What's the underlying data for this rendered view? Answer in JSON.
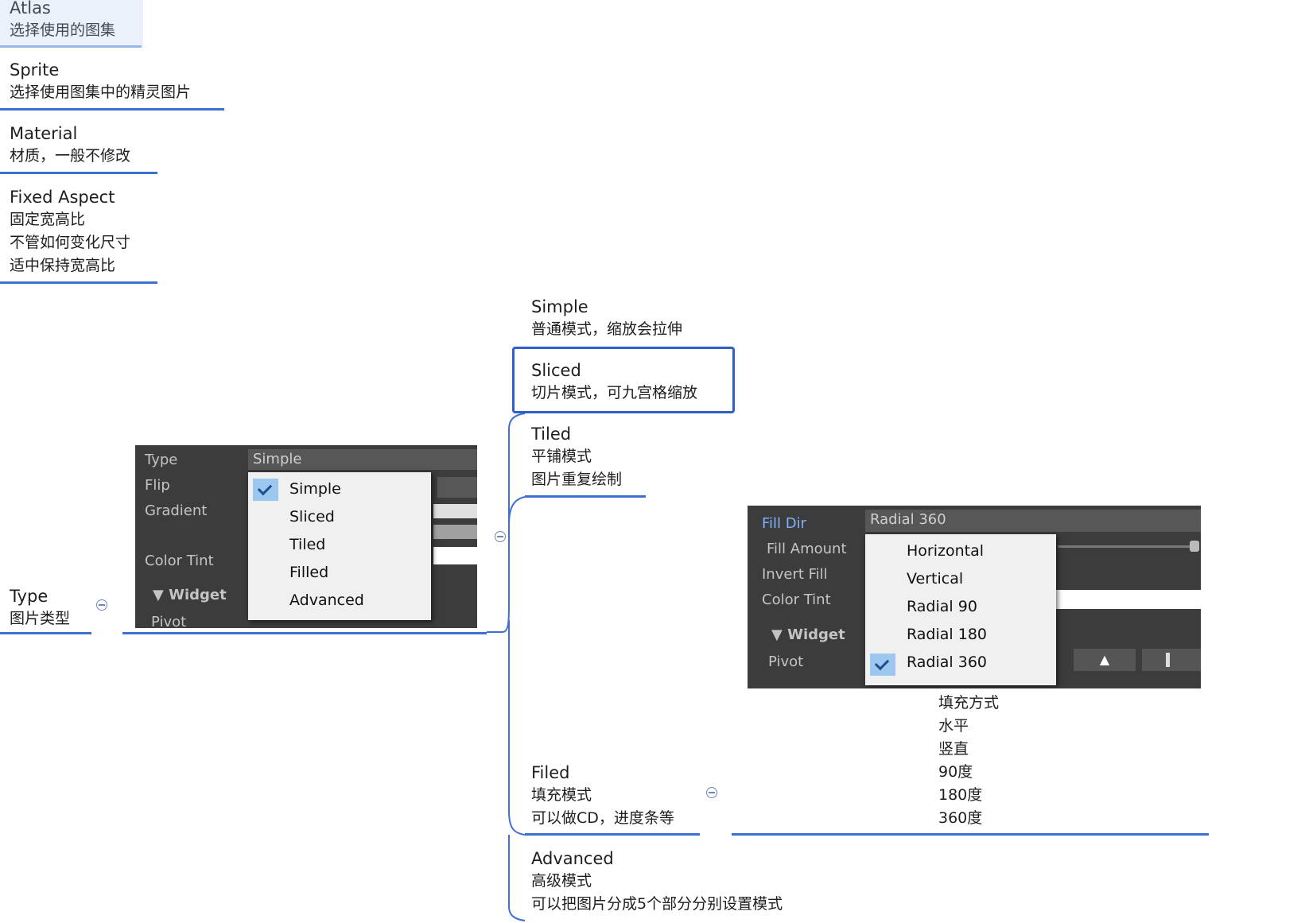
{
  "left_nodes": {
    "atlas": {
      "title": "Atlas",
      "desc": "选择使用的图集"
    },
    "sprite": {
      "title": "Sprite",
      "desc": "选择使用图集中的精灵图片"
    },
    "material": {
      "title": "Material",
      "desc": "材质，一般不修改"
    },
    "fixed_aspect": {
      "title": "Fixed Aspect",
      "lines": [
        "固定宽高比",
        "不管如何变化尺寸",
        "适中保持宽高比"
      ]
    },
    "type": {
      "title": "Type",
      "desc": "图片类型"
    }
  },
  "type_panel": {
    "labels": [
      "Type",
      "Flip",
      "Gradient",
      "Color Tint",
      "▼ Widget",
      "Pivot"
    ],
    "field_value": "Simple",
    "options": [
      "Simple",
      "Sliced",
      "Tiled",
      "Filled",
      "Advanced"
    ],
    "checked": "Simple"
  },
  "modes": {
    "simple": {
      "title": "Simple",
      "desc": "普通模式，缩放会拉伸"
    },
    "sliced": {
      "title": "Sliced",
      "desc": "切片模式，可九宫格缩放"
    },
    "tiled": {
      "title": "Tiled",
      "lines": [
        "平铺模式",
        "图片重复绘制"
      ]
    },
    "filed": {
      "title": "Filed",
      "lines": [
        "填充模式",
        "可以做CD，进度条等"
      ]
    },
    "advanced": {
      "title": "Advanced",
      "lines": [
        "高级模式",
        "可以把图片分成5个部分分别设置模式"
      ]
    }
  },
  "fill_panel": {
    "labels": [
      "Fill Dir",
      "Fill Amount",
      "Invert Fill",
      "Color Tint",
      "▼ Widget",
      "Pivot"
    ],
    "field_value": "Radial 360",
    "options": [
      "Horizontal",
      "Vertical",
      "Radial 90",
      "Radial 180",
      "Radial 360"
    ],
    "checked": "Radial 360",
    "arrow_glyph": "▲"
  },
  "fill_notes": [
    "填充方式",
    "水平",
    "竖直",
    "90度",
    "180度",
    "360度"
  ],
  "colors": {
    "accent": "#3f6fd1",
    "panel": "#3c3c3c",
    "popup": "#f0f0f0",
    "check": "#9cc8f0"
  }
}
